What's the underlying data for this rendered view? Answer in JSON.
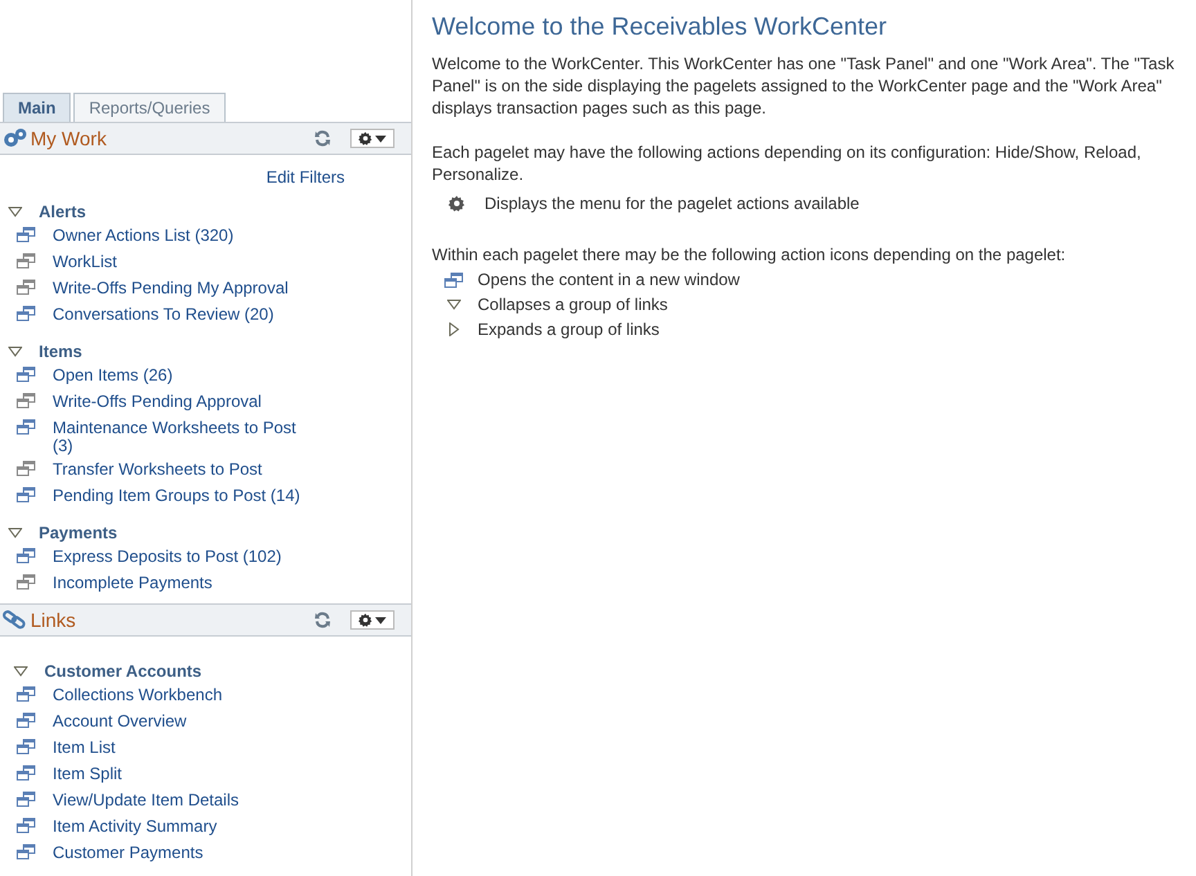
{
  "tabs": [
    {
      "label": "Main",
      "selected": true
    },
    {
      "label": "Reports/Queries",
      "selected": false
    }
  ],
  "my_work": {
    "title": "My Work",
    "edit_filters": "Edit Filters",
    "groups": [
      {
        "label": "Alerts",
        "expanded": true,
        "items": [
          {
            "label": "Owner Actions List (320)",
            "icon_active": true
          },
          {
            "label": "WorkList",
            "icon_active": false
          },
          {
            "label": "Write-Offs Pending My Approval",
            "icon_active": false
          },
          {
            "label": "Conversations To Review (20)",
            "icon_active": true
          }
        ]
      },
      {
        "label": "Items",
        "expanded": true,
        "items": [
          {
            "label": "Open Items (26)",
            "icon_active": true
          },
          {
            "label": "Write-Offs Pending Approval",
            "icon_active": false
          },
          {
            "label": "Maintenance Worksheets to Post (3)",
            "icon_active": true
          },
          {
            "label": "Transfer Worksheets to Post",
            "icon_active": false
          },
          {
            "label": "Pending Item Groups to Post (14)",
            "icon_active": true
          }
        ]
      },
      {
        "label": "Payments",
        "expanded": true,
        "items": [
          {
            "label": "Express Deposits to Post (102)",
            "icon_active": true
          },
          {
            "label": "Incomplete Payments",
            "icon_active": false
          }
        ]
      }
    ]
  },
  "links": {
    "title": "Links",
    "groups": [
      {
        "label": "Customer Accounts",
        "expanded": true,
        "items": [
          {
            "label": "Collections Workbench"
          },
          {
            "label": "Account Overview"
          },
          {
            "label": "Item List"
          },
          {
            "label": "Item Split"
          },
          {
            "label": "View/Update Item Details"
          },
          {
            "label": "Item Activity Summary"
          },
          {
            "label": "Customer Payments"
          }
        ]
      }
    ]
  },
  "work_area": {
    "title": "Welcome to the Receivables WorkCenter",
    "intro": "Welcome to the WorkCenter. This WorkCenter has one \"Task Panel\" and one \"Work Area\". The \"Task Panel\" is on the side displaying the pagelets assigned to the WorkCenter page and the \"Work Area\" displays transaction pages such as this page.",
    "actions_text": "Each pagelet may have the following actions depending on its configuration: Hide/Show, Reload, Personalize.",
    "action_items": [
      {
        "kind": "gear",
        "text": "Displays the menu for the pagelet actions available"
      }
    ],
    "icons_text": "Within each pagelet there may be the following action icons depending on the pagelet:",
    "icon_items": [
      {
        "kind": "window",
        "text": "Opens the content in a new window"
      },
      {
        "kind": "collapse",
        "text": "Collapses a group of links"
      },
      {
        "kind": "expand",
        "text": "Expands a group of links"
      }
    ]
  }
}
